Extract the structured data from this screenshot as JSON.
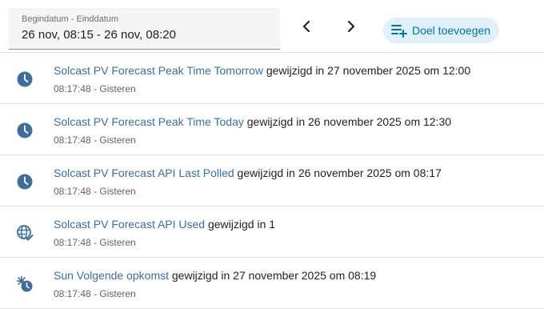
{
  "toolbar": {
    "date_label": "Begindatum - Einddatum",
    "date_value": "26 nov, 08:15 - 26 nov, 08:20",
    "prev_icon": "chevron-left-icon",
    "next_icon": "chevron-right-icon",
    "add_icon": "playlist-plus-icon",
    "add_label": "Doel toevoegen",
    "accent": "#03729e",
    "accent_bg": "#dff0fa"
  },
  "entries": [
    {
      "icon": "clock-icon",
      "entity": "Solcast PV Forecast Peak Time Tomorrow",
      "message": " gewijzigd in 27 november 2025 om 12:00",
      "meta": "08:17:48 - Gisteren"
    },
    {
      "icon": "clock-icon",
      "entity": "Solcast PV Forecast Peak Time Today",
      "message": " gewijzigd in 26 november 2025 om 12:30",
      "meta": "08:17:48 - Gisteren"
    },
    {
      "icon": "clock-icon",
      "entity": "Solcast PV Forecast API Last Polled",
      "message": " gewijzigd in 26 november 2025 om 08:17",
      "meta": "08:17:48 - Gisteren"
    },
    {
      "icon": "web-check-icon",
      "entity": "Solcast PV Forecast API Used",
      "message": " gewijzigd in 1",
      "meta": "08:17:48 - Gisteren"
    },
    {
      "icon": "sun-clock-icon",
      "entity": "Sun Volgende opkomst",
      "message": " gewijzigd in 27 november 2025 om 08:19",
      "meta": "08:17:48 - Gisteren"
    }
  ]
}
